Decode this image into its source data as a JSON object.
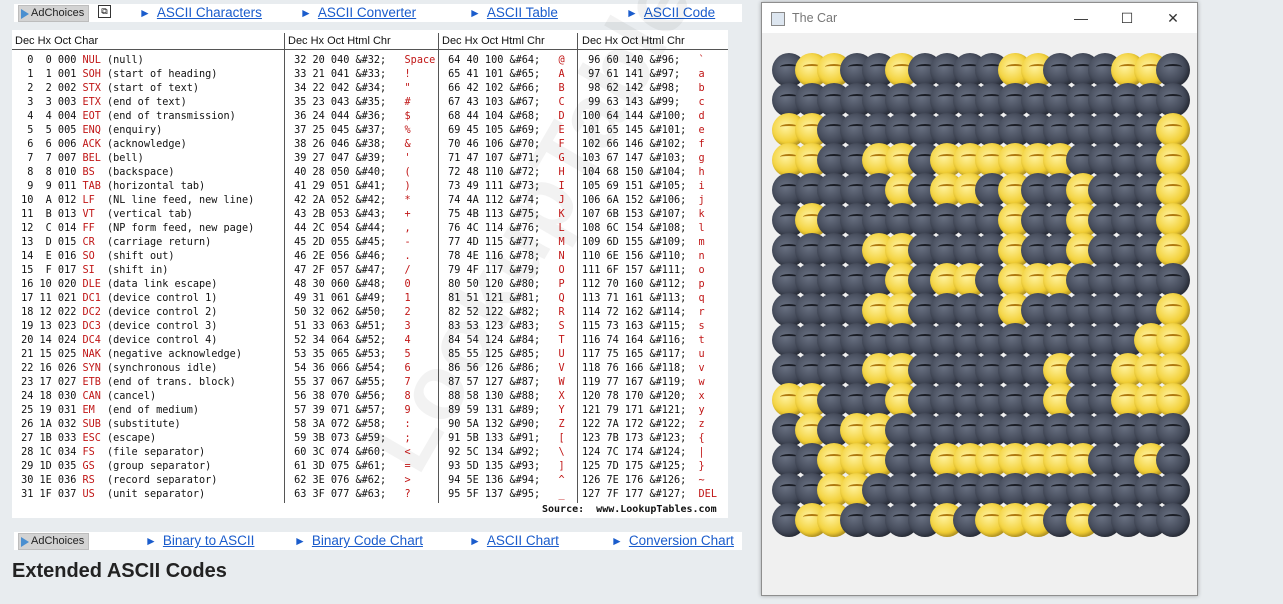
{
  "colors": {
    "link": "#1a5ccc",
    "red": "#c01515",
    "moon_dark": "#3d4352",
    "moon_gold": "#f2cf35"
  },
  "top_bar": {
    "adchoices": "AdChoices",
    "links": [
      "ASCII Characters",
      "ASCII Converter",
      "ASCII Table",
      "ASCII Code"
    ]
  },
  "bottom_bar": {
    "adchoices": "AdChoices",
    "links": [
      "Binary to ASCII",
      "Binary Code Chart",
      "ASCII Chart",
      "Conversion Chart"
    ]
  },
  "table": {
    "headers": [
      "Dec  Hx Oct  Char",
      "Dec  Hx Oct   Html  Chr",
      "Dec  Hx Oct   Html  Chr",
      "Dec  Hx Oct  Html  Chr"
    ],
    "control": [
      [
        "0",
        "0",
        "000",
        "NUL",
        "(null)"
      ],
      [
        "1",
        "1",
        "001",
        "SOH",
        "(start of heading)"
      ],
      [
        "2",
        "2",
        "002",
        "STX",
        "(start of text)"
      ],
      [
        "3",
        "3",
        "003",
        "ETX",
        "(end of text)"
      ],
      [
        "4",
        "4",
        "004",
        "EOT",
        "(end of transmission)"
      ],
      [
        "5",
        "5",
        "005",
        "ENQ",
        "(enquiry)"
      ],
      [
        "6",
        "6",
        "006",
        "ACK",
        "(acknowledge)"
      ],
      [
        "7",
        "7",
        "007",
        "BEL",
        "(bell)"
      ],
      [
        "8",
        "8",
        "010",
        "BS",
        "(backspace)"
      ],
      [
        "9",
        "9",
        "011",
        "TAB",
        "(horizontal tab)"
      ],
      [
        "10",
        "A",
        "012",
        "LF",
        "(NL line feed, new line)"
      ],
      [
        "11",
        "B",
        "013",
        "VT",
        "(vertical tab)"
      ],
      [
        "12",
        "C",
        "014",
        "FF",
        "(NP form feed, new page)"
      ],
      [
        "13",
        "D",
        "015",
        "CR",
        "(carriage return)"
      ],
      [
        "14",
        "E",
        "016",
        "SO",
        "(shift out)"
      ],
      [
        "15",
        "F",
        "017",
        "SI",
        "(shift in)"
      ],
      [
        "16",
        "10",
        "020",
        "DLE",
        "(data link escape)"
      ],
      [
        "17",
        "11",
        "021",
        "DC1",
        "(device control 1)"
      ],
      [
        "18",
        "12",
        "022",
        "DC2",
        "(device control 2)"
      ],
      [
        "19",
        "13",
        "023",
        "DC3",
        "(device control 3)"
      ],
      [
        "20",
        "14",
        "024",
        "DC4",
        "(device control 4)"
      ],
      [
        "21",
        "15",
        "025",
        "NAK",
        "(negative acknowledge)"
      ],
      [
        "22",
        "16",
        "026",
        "SYN",
        "(synchronous idle)"
      ],
      [
        "23",
        "17",
        "027",
        "ETB",
        "(end of trans. block)"
      ],
      [
        "24",
        "18",
        "030",
        "CAN",
        "(cancel)"
      ],
      [
        "25",
        "19",
        "031",
        "EM",
        "(end of medium)"
      ],
      [
        "26",
        "1A",
        "032",
        "SUB",
        "(substitute)"
      ],
      [
        "27",
        "1B",
        "033",
        "ESC",
        "(escape)"
      ],
      [
        "28",
        "1C",
        "034",
        "FS",
        "(file separator)"
      ],
      [
        "29",
        "1D",
        "035",
        "GS",
        "(group separator)"
      ],
      [
        "30",
        "1E",
        "036",
        "RS",
        "(record separator)"
      ],
      [
        "31",
        "1F",
        "037",
        "US",
        "(unit separator)"
      ]
    ],
    "chr_col2": [
      "Space",
      "!",
      "\"",
      "#",
      "$",
      "%",
      "&",
      "'",
      "(",
      ")",
      "*",
      "+",
      ",",
      "-",
      ".",
      "/",
      "0",
      "1",
      "2",
      "3",
      "4",
      "5",
      "6",
      "7",
      "8",
      "9",
      ":",
      ";",
      "<",
      "=",
      ">",
      "?"
    ],
    "chr_col3": [
      "@",
      "A",
      "B",
      "C",
      "D",
      "E",
      "F",
      "G",
      "H",
      "I",
      "J",
      "K",
      "L",
      "M",
      "N",
      "O",
      "P",
      "Q",
      "R",
      "S",
      "T",
      "U",
      "V",
      "W",
      "X",
      "Y",
      "Z",
      "[",
      "\\",
      "]",
      "^",
      "_"
    ],
    "chr_col4": [
      "`",
      "a",
      "b",
      "c",
      "d",
      "e",
      "f",
      "g",
      "h",
      "i",
      "j",
      "k",
      "l",
      "m",
      "n",
      "o",
      "p",
      "q",
      "r",
      "s",
      "t",
      "u",
      "v",
      "w",
      "x",
      "y",
      "z",
      "{",
      "|",
      "}",
      "~",
      "DEL"
    ],
    "source": "Source:  www.LookupTables.com",
    "watermark": "LookupTables"
  },
  "section_heading": "Extended ASCII Codes",
  "window": {
    "title": "The Car",
    "controls": [
      "minimize",
      "maximize",
      "close"
    ]
  },
  "moon_grid": {
    "rows": [
      "DGGDDGDDDDGGDDDGGD",
      "DDDDDDDDDDDDDDDDDD",
      "GGDDDDDDDDDDDDDDDG",
      "GGDDGGDGGGGGGDDDDG",
      "DDDDDGDGGDGDDGDDDG",
      "DGDDDDDDDDGDDGDDDG",
      "DDDDGGDDDDGDDGDDDG",
      "DDDDDGDGGDGGGDDDDD",
      "DDDDGGDDDDGDDDDDDG",
      "DDDDDDDDDDDDDDDDGG",
      "DDDDGGDDDDDDGDDGGG",
      "GGDDDGDDDDDDGDDGGG",
      "DGDGGDDDDDDDDDDDDD",
      "DDGGGDDGGGGGGGDDGD",
      "DDGGDDDDDDDDDDDDDD",
      "DGGDDDDGDGGGDGDDDD"
    ]
  }
}
